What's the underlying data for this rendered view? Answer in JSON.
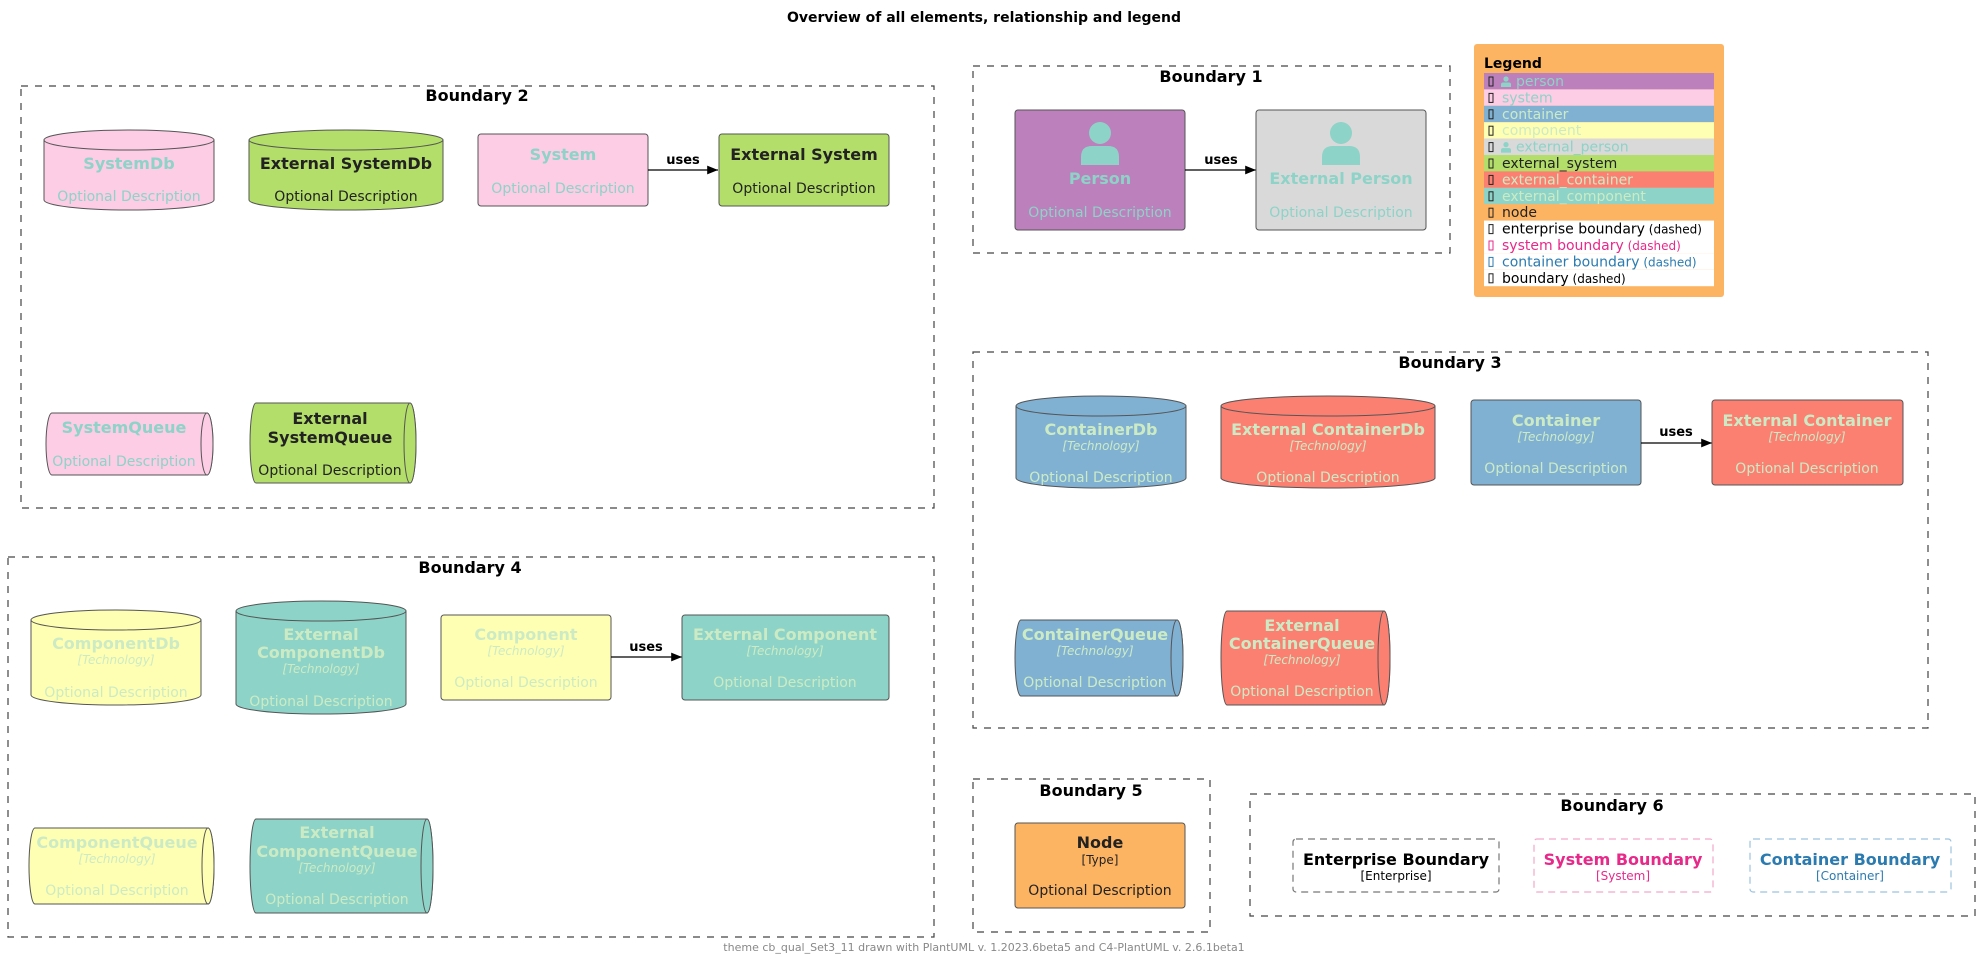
{
  "title": "Overview of all elements, relationship and legend",
  "footer": "theme cb_qual_Set3_11 drawn with PlantUML v. 1.2023.6beta5 and C4-PlantUML v. 2.6.1beta1",
  "colors": {
    "person": "#bc80bd",
    "system": "#fccde5",
    "container": "#80b1d3",
    "component": "#ffffb3",
    "external_person": "#d9d9d9",
    "external_system": "#b3de69",
    "external_container": "#fb8072",
    "external_component": "#8dd3c7",
    "node": "#fdb462",
    "text_teal": "#8dd3c7",
    "text_light_green": "#ccebc5",
    "text_dark": "#222222",
    "system_boundary": "#e7298a",
    "container_boundary": "#2b7bb0"
  },
  "boundaries": {
    "b1": "Boundary 1",
    "b2": "Boundary 2",
    "b3": "Boundary 3",
    "b4": "Boundary 4",
    "b5": "Boundary 5",
    "b6": "Boundary 6"
  },
  "elements": {
    "person": {
      "name": "Person",
      "desc": "Optional Description"
    },
    "external_person": {
      "name": "External Person",
      "desc": "Optional Description"
    },
    "system_db": {
      "name": "SystemDb",
      "desc": "Optional Description"
    },
    "external_system_db": {
      "name": "External SystemDb",
      "desc": "Optional Description"
    },
    "system": {
      "name": "System",
      "desc": "Optional Description"
    },
    "external_system": {
      "name": "External System",
      "desc": "Optional Description"
    },
    "system_queue": {
      "name": "SystemQueue",
      "desc": "Optional Description"
    },
    "external_system_queue": {
      "name_line1": "External",
      "name_line2": "SystemQueue",
      "desc": "Optional Description"
    },
    "container_db": {
      "name": "ContainerDb",
      "tech": "[Technology]",
      "desc": "Optional Description"
    },
    "external_container_db": {
      "name": "External ContainerDb",
      "tech": "[Technology]",
      "desc": "Optional Description"
    },
    "container": {
      "name": "Container",
      "tech": "[Technology]",
      "desc": "Optional Description"
    },
    "external_container": {
      "name": "External Container",
      "tech": "[Technology]",
      "desc": "Optional Description"
    },
    "container_queue": {
      "name": "ContainerQueue",
      "tech": "[Technology]",
      "desc": "Optional Description"
    },
    "external_container_queue": {
      "name_line1": "External",
      "name_line2": "ContainerQueue",
      "tech": "[Technology]",
      "desc": "Optional Description"
    },
    "component_db": {
      "name": "ComponentDb",
      "tech": "[Technology]",
      "desc": "Optional Description"
    },
    "external_component_db": {
      "name_line1": "External",
      "name_line2": "ComponentDb",
      "tech": "[Technology]",
      "desc": "Optional Description"
    },
    "component": {
      "name": "Component",
      "tech": "[Technology]",
      "desc": "Optional Description"
    },
    "external_component": {
      "name": "External Component",
      "tech": "[Technology]",
      "desc": "Optional Description"
    },
    "component_queue": {
      "name": "ComponentQueue",
      "tech": "[Technology]",
      "desc": "Optional Description"
    },
    "external_component_queue": {
      "name_line1": "External",
      "name_line2": "ComponentQueue",
      "tech": "[Technology]",
      "desc": "Optional Description"
    },
    "node": {
      "name": "Node",
      "tech": "[Type]",
      "desc": "Optional Description"
    },
    "enterprise_boundary": {
      "name": "Enterprise Boundary",
      "type": "[Enterprise]"
    },
    "system_boundary": {
      "name": "System Boundary",
      "type": "[System]"
    },
    "container_boundary": {
      "name": "Container Boundary",
      "type": "[Container]"
    }
  },
  "relationships": {
    "person_uses": "uses",
    "system_uses": "uses",
    "container_uses": "uses",
    "component_uses": "uses"
  },
  "legend": {
    "title": "Legend",
    "items": [
      {
        "label": "person",
        "icon": "person-icon"
      },
      {
        "label": "system"
      },
      {
        "label": "container"
      },
      {
        "label": "component"
      },
      {
        "label": "external_person",
        "icon": "person-icon"
      },
      {
        "label": "external_system"
      },
      {
        "label": "external_container"
      },
      {
        "label": "external_component"
      },
      {
        "label": "node"
      },
      {
        "label": "enterprise boundary",
        "suffix": "(dashed)"
      },
      {
        "label": "system boundary",
        "suffix": "(dashed)"
      },
      {
        "label": "container boundary",
        "suffix": "(dashed)"
      },
      {
        "label": "boundary",
        "suffix": "(dashed)"
      }
    ]
  }
}
